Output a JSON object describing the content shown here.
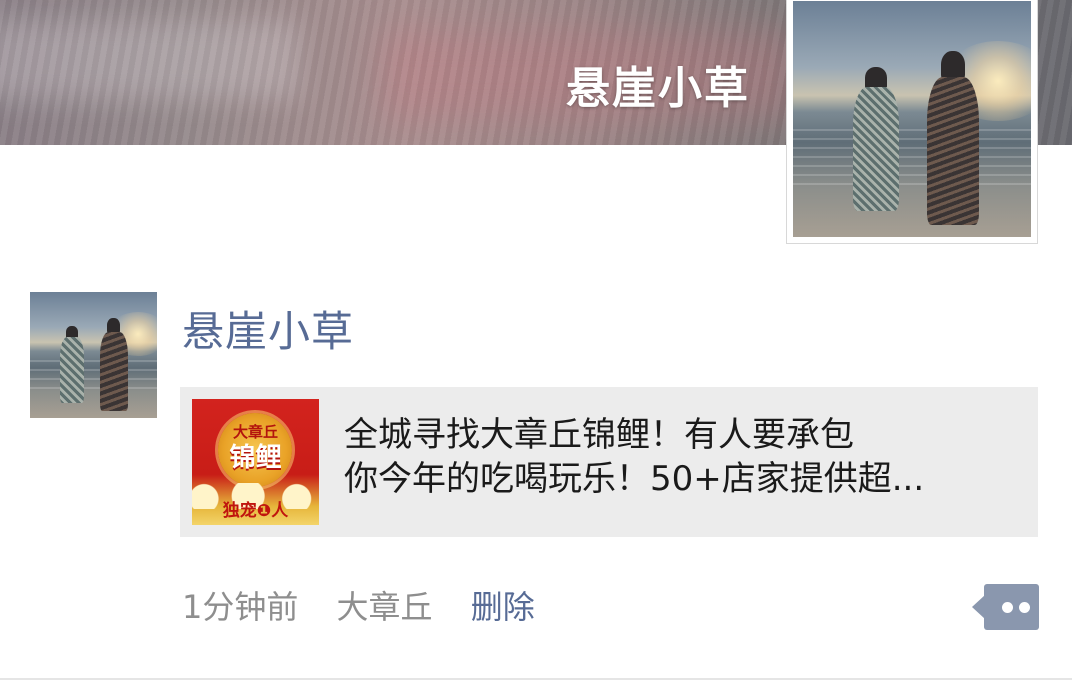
{
  "cover": {
    "name": "悬崖小草"
  },
  "post": {
    "username": "悬崖小草",
    "link": {
      "thumbnail": {
        "top_text": "大章丘",
        "main_text": "锦鲤",
        "bottom_text": "独宠❶人"
      },
      "title_line1": "全城寻找大章丘锦鲤！有人要承包",
      "title_line2": "你今年的吃喝玩乐！50+店家提供超..."
    },
    "time": "1分钟前",
    "location": "大章丘",
    "delete_label": "删除",
    "more_icon": "comment-more-icon"
  },
  "colors": {
    "link_blue": "#576b95",
    "meta_gray": "#8e8e8e",
    "card_bg": "#ececec",
    "more_button": "#8a97ae"
  }
}
